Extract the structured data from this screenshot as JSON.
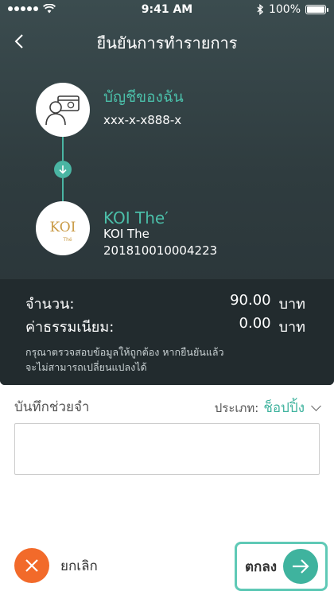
{
  "status_bar": {
    "time": "9:41 AM",
    "battery": "100%"
  },
  "header": {
    "title": "ยืนยันการทำรายการ"
  },
  "from_account": {
    "name": "บัญชีของฉัน",
    "number": "xxx-x-x888-x"
  },
  "to_account": {
    "display_name": "KOI The′",
    "name": "KOI The",
    "id": "201810010004223",
    "logo_text": "KOI",
    "logo_sub": "Thé"
  },
  "summary": {
    "amount_label": "จำนวน:",
    "amount_value": "90.00",
    "amount_unit": "บาท",
    "fee_label": "ค่าธรรมเนียม:",
    "fee_value": "0.00",
    "fee_unit": "บาท",
    "note_line1": "กรุณาตรวจสอบข้อมูลให้ถูกต้อง หากยืนยันแล้ว",
    "note_line2": "จะไม่สามารถเปลี่ยนแปลงได้"
  },
  "memo": {
    "label": "บันทึกช่วยจำ",
    "category_label": "ประเภท:",
    "category_value": "ช็อปปิ้ง",
    "value": "",
    "placeholder": ""
  },
  "actions": {
    "cancel_label": "ยกเลิก",
    "confirm_label": "ตกลง"
  },
  "colors": {
    "accent": "#3fb39e",
    "cancel": "#f26a2a",
    "panel": "#2f3c3f",
    "logo_gold": "#c99a44"
  },
  "icons": {
    "back": "chevron-left-icon",
    "from_avatar": "user-card-icon",
    "flow_arrow": "arrow-down-icon",
    "cancel": "close-icon",
    "confirm": "arrow-right-icon"
  }
}
